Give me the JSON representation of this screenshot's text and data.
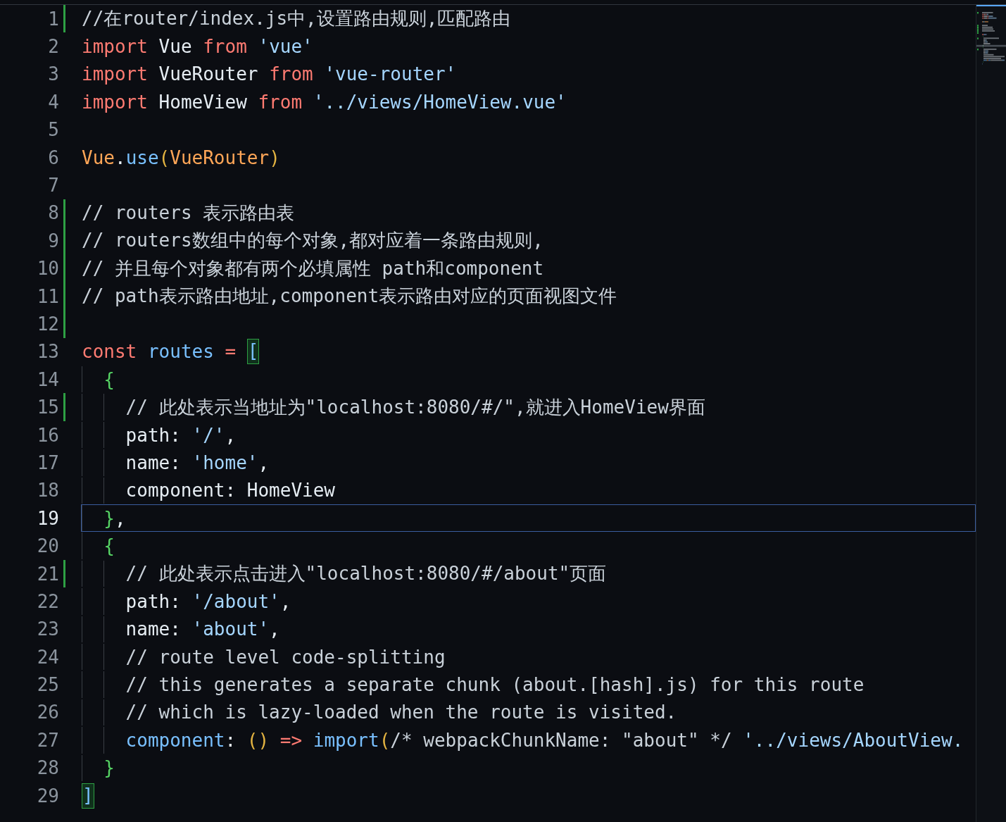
{
  "editor": {
    "lines": [
      {
        "number": "1",
        "changed": true,
        "current": false,
        "tokens": [
          {
            "kind": "comment",
            "text": "//在router/index.js中,设置路由规则,匹配路由"
          }
        ]
      },
      {
        "number": "2",
        "changed": false,
        "current": false,
        "tokens": [
          {
            "kind": "keyword",
            "text": "import "
          },
          {
            "kind": "plain",
            "text": "Vue "
          },
          {
            "kind": "keyword",
            "text": "from "
          },
          {
            "kind": "string",
            "text": "'vue'"
          }
        ]
      },
      {
        "number": "3",
        "changed": false,
        "current": false,
        "tokens": [
          {
            "kind": "keyword",
            "text": "import "
          },
          {
            "kind": "plain",
            "text": "VueRouter "
          },
          {
            "kind": "keyword",
            "text": "from "
          },
          {
            "kind": "string",
            "text": "'vue-router'"
          }
        ]
      },
      {
        "number": "4",
        "changed": false,
        "current": false,
        "tokens": [
          {
            "kind": "keyword",
            "text": "import "
          },
          {
            "kind": "plain",
            "text": "HomeView "
          },
          {
            "kind": "keyword",
            "text": "from "
          },
          {
            "kind": "string",
            "text": "'../views/HomeView.vue'"
          }
        ]
      },
      {
        "number": "5",
        "changed": false,
        "current": false
      },
      {
        "number": "6",
        "changed": false,
        "current": false,
        "tokens": [
          {
            "kind": "class",
            "text": "Vue"
          },
          {
            "kind": "plain",
            "text": "."
          },
          {
            "kind": "function",
            "text": "use"
          },
          {
            "kind": "paren",
            "text": "("
          },
          {
            "kind": "class",
            "text": "VueRouter"
          },
          {
            "kind": "paren",
            "text": ")"
          }
        ]
      },
      {
        "number": "7",
        "changed": false,
        "current": false
      },
      {
        "number": "8",
        "changed": true,
        "current": false,
        "tokens": [
          {
            "kind": "comment",
            "text": "// routers 表示路由表"
          }
        ]
      },
      {
        "number": "9",
        "changed": true,
        "current": false,
        "tokens": [
          {
            "kind": "comment",
            "text": "// routers数组中的每个对象,都对应着一条路由规则,"
          }
        ]
      },
      {
        "number": "10",
        "changed": true,
        "current": false,
        "tokens": [
          {
            "kind": "comment",
            "text": "// 并且每个对象都有两个必填属性 path和component"
          }
        ]
      },
      {
        "number": "11",
        "changed": true,
        "current": false,
        "tokens": [
          {
            "kind": "comment",
            "text": "// path表示路由地址,component表示路由对应的页面视图文件"
          }
        ]
      },
      {
        "number": "12",
        "changed": true,
        "current": false
      },
      {
        "number": "13",
        "changed": false,
        "current": false,
        "tokens": [
          {
            "kind": "keyword",
            "text": "const "
          },
          {
            "kind": "variable",
            "text": "routes "
          },
          {
            "kind": "keyword",
            "text": "= "
          },
          {
            "kind": "bracket_match",
            "text": "["
          }
        ]
      },
      {
        "number": "14",
        "changed": false,
        "current": false,
        "tokens": [
          {
            "kind": "brace",
            "text": "  {"
          }
        ]
      },
      {
        "number": "15",
        "changed": true,
        "current": false,
        "tokens": [
          {
            "kind": "comment",
            "text": "    // 此处表示当地址为\"localhost:8080/#/\",就进入HomeView界面"
          }
        ]
      },
      {
        "number": "16",
        "changed": false,
        "current": false,
        "tokens": [
          {
            "kind": "plain",
            "text": "    path: "
          },
          {
            "kind": "string",
            "text": "'/'"
          },
          {
            "kind": "plain",
            "text": ","
          }
        ]
      },
      {
        "number": "17",
        "changed": false,
        "current": false,
        "tokens": [
          {
            "kind": "plain",
            "text": "    name: "
          },
          {
            "kind": "string",
            "text": "'home'"
          },
          {
            "kind": "plain",
            "text": ","
          }
        ]
      },
      {
        "number": "18",
        "changed": false,
        "current": false,
        "tokens": [
          {
            "kind": "plain",
            "text": "    component: HomeView"
          }
        ]
      },
      {
        "number": "19",
        "changed": false,
        "current": true,
        "tokens": [
          {
            "kind": "brace",
            "text": "  }"
          },
          {
            "kind": "plain",
            "text": ","
          }
        ]
      },
      {
        "number": "20",
        "changed": false,
        "current": false,
        "tokens": [
          {
            "kind": "brace",
            "text": "  {"
          }
        ]
      },
      {
        "number": "21",
        "changed": true,
        "current": false,
        "tokens": [
          {
            "kind": "comment",
            "text": "    // 此处表示点击进入\"localhost:8080/#/about\"页面"
          }
        ]
      },
      {
        "number": "22",
        "changed": false,
        "current": false,
        "tokens": [
          {
            "kind": "plain",
            "text": "    path: "
          },
          {
            "kind": "string",
            "text": "'/about'"
          },
          {
            "kind": "plain",
            "text": ","
          }
        ]
      },
      {
        "number": "23",
        "changed": false,
        "current": false,
        "tokens": [
          {
            "kind": "plain",
            "text": "    name: "
          },
          {
            "kind": "string",
            "text": "'about'"
          },
          {
            "kind": "plain",
            "text": ","
          }
        ]
      },
      {
        "number": "24",
        "changed": false,
        "current": false,
        "tokens": [
          {
            "kind": "comment",
            "text": "    // route level code-splitting"
          }
        ]
      },
      {
        "number": "25",
        "changed": false,
        "current": false,
        "tokens": [
          {
            "kind": "comment",
            "text": "    // this generates a separate chunk (about.[hash].js) for this route"
          }
        ]
      },
      {
        "number": "26",
        "changed": false,
        "current": false,
        "tokens": [
          {
            "kind": "comment",
            "text": "    // which is lazy-loaded when the route is visited."
          }
        ]
      },
      {
        "number": "27",
        "changed": false,
        "current": false,
        "tokens": [
          {
            "kind": "function",
            "text": "    component"
          },
          {
            "kind": "plain",
            "text": ": "
          },
          {
            "kind": "paren",
            "text": "() "
          },
          {
            "kind": "keyword",
            "text": "=> "
          },
          {
            "kind": "function",
            "text": "import"
          },
          {
            "kind": "paren",
            "text": "("
          },
          {
            "kind": "comment",
            "text": "/* webpackChunkName: \"about\" */ "
          },
          {
            "kind": "string",
            "text": "'../views/AboutView."
          }
        ]
      },
      {
        "number": "28",
        "changed": false,
        "current": false,
        "tokens": [
          {
            "kind": "brace",
            "text": "  }"
          }
        ]
      },
      {
        "number": "29",
        "changed": false,
        "current": false,
        "tokens": [
          {
            "kind": "bracket_match",
            "text": "]"
          }
        ]
      }
    ]
  }
}
